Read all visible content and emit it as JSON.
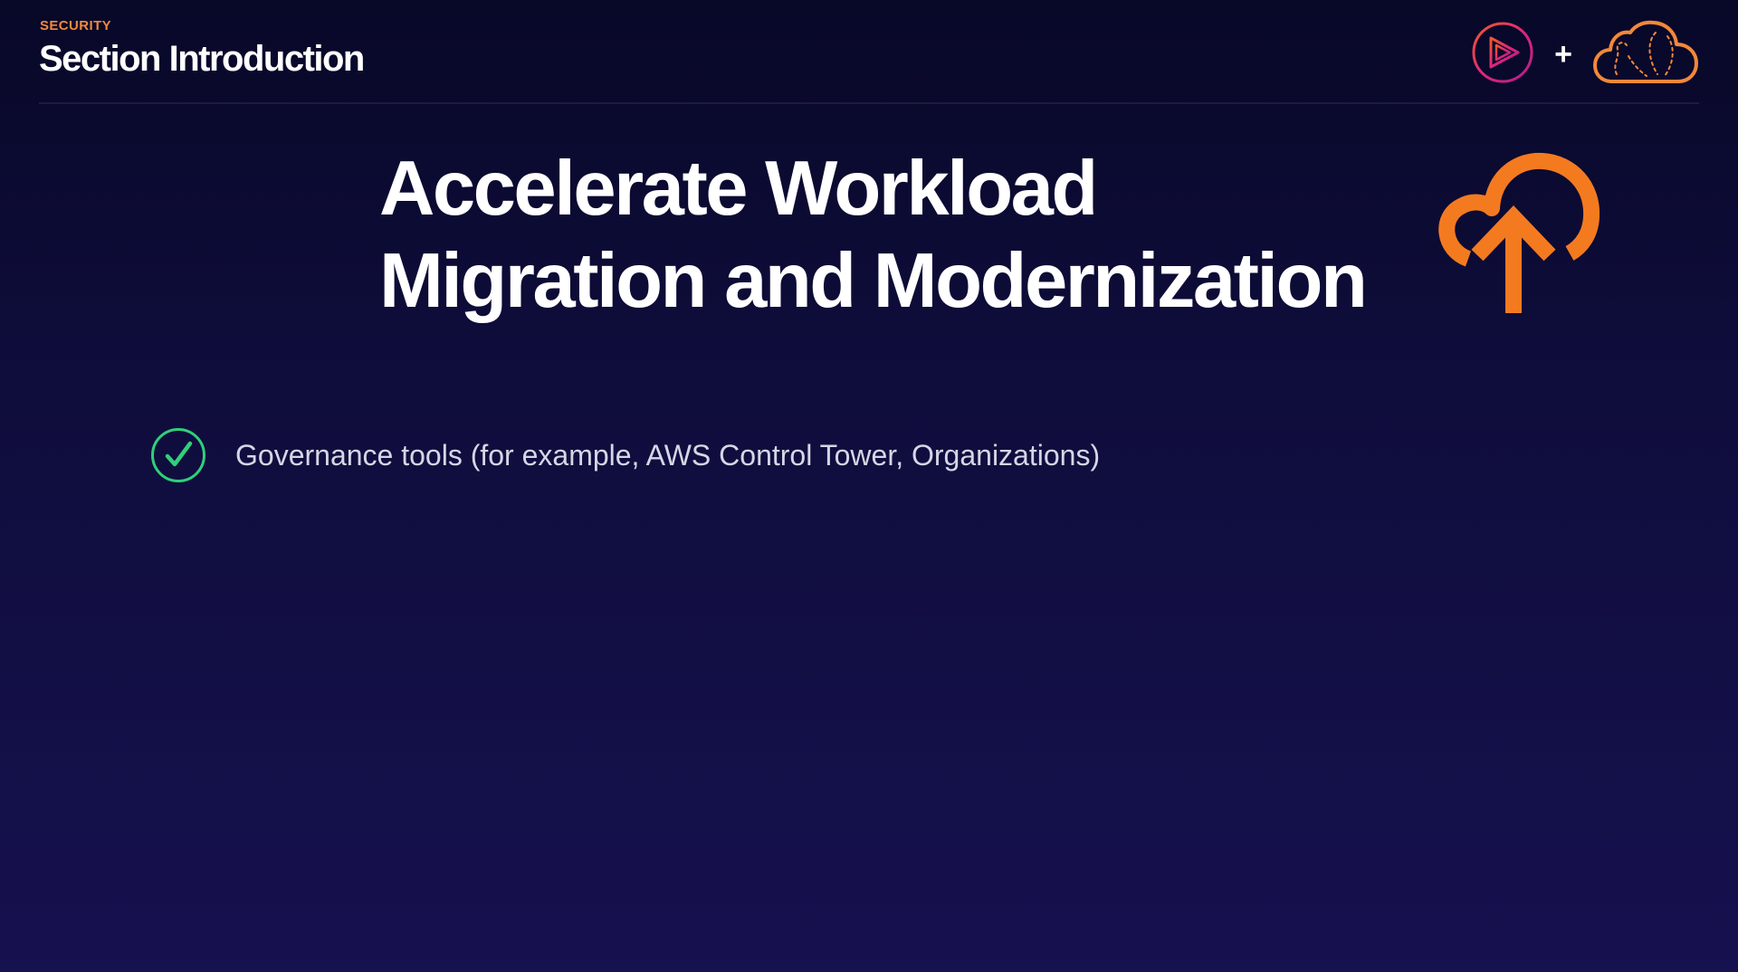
{
  "header": {
    "eyebrow": "SECURITY",
    "title": "Section Introduction"
  },
  "logos": {
    "left_icon": "play-circle-logo-icon",
    "plus": "+",
    "right_icon": "cloud-logo-icon"
  },
  "slide": {
    "title_line_1": "Accelerate Workload",
    "title_line_2": "Migration and Modernization",
    "icon": "cloud-upload-icon",
    "bullets": [
      {
        "icon": "check-circle-icon",
        "text": "Governance tools (for example, AWS Control Tower, Organizations)"
      }
    ]
  },
  "colors": {
    "accent_orange": "#f2883a",
    "check_green": "#2fd07a",
    "logo_magenta": "#e0267a"
  }
}
